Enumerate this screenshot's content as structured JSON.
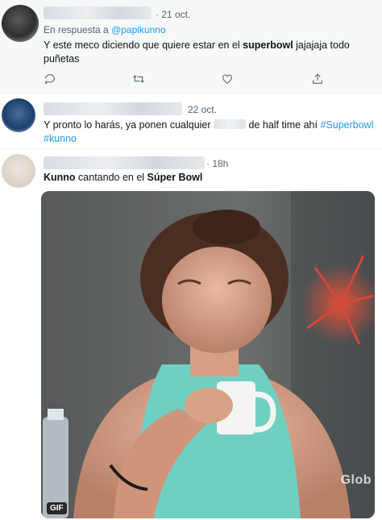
{
  "tweets": [
    {
      "time": "· 21 oct.",
      "reply_prefix": "En respuesta a ",
      "reply_mention": "@papikunno",
      "text_before": "Y este meco diciendo que quiere estar en el ",
      "text_bold": "superbowl",
      "text_after": " jajajaja todo",
      "text_line2": "puñetas"
    },
    {
      "time": "22 oct.",
      "text_before": "Y pronto lo harás, ya ponen cualquier ",
      "text_after": " de half time ahí ",
      "hashtag1": "#Superbowl",
      "hashtag2": "#kunno"
    },
    {
      "time": "· 18h",
      "text_bold1": "Kunno",
      "text_mid": " cantando en el ",
      "text_bold2": "Súper Bowl",
      "media_badge": "GIF",
      "media_watermark": "Glob"
    }
  ],
  "icons": [
    "reply-icon",
    "retweet-icon",
    "like-icon",
    "share-icon"
  ],
  "colors": {
    "accent": "#1d9bf0",
    "muted": "#536471",
    "highlight_bg": "#f7f9f9"
  }
}
